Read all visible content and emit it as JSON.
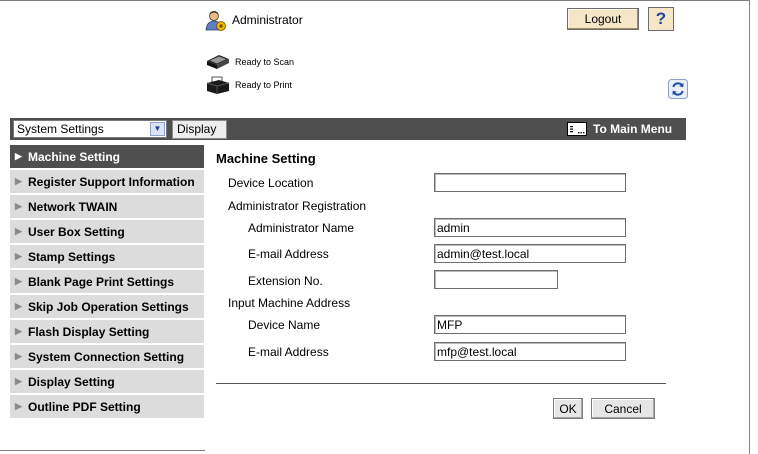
{
  "header": {
    "user_label": "Administrator",
    "logout_label": "Logout",
    "help_label": "?"
  },
  "status": {
    "scan": "Ready to Scan",
    "print": "Ready to Print"
  },
  "toolbar": {
    "settings_select_value": "System Settings",
    "display_label": "Display",
    "main_menu_label": "To Main Menu"
  },
  "sidebar": {
    "items": [
      {
        "label": "Machine Setting"
      },
      {
        "label": "Register Support Information"
      },
      {
        "label": "Network TWAIN"
      },
      {
        "label": "User Box Setting"
      },
      {
        "label": "Stamp Settings"
      },
      {
        "label": "Blank Page Print Settings"
      },
      {
        "label": "Skip Job Operation Settings"
      },
      {
        "label": "Flash Display Setting"
      },
      {
        "label": "System Connection Setting"
      },
      {
        "label": "Display Setting"
      },
      {
        "label": "Outline PDF Setting"
      }
    ]
  },
  "form": {
    "title": "Machine Setting",
    "device_location_label": "Device Location",
    "device_location_value": "",
    "admin_registration_label": "Administrator Registration",
    "admin_name_label": "Administrator Name",
    "admin_name_value": "admin",
    "admin_email_label": "E-mail Address",
    "admin_email_value": "admin@test.local",
    "extension_label": "Extension No.",
    "extension_value": "",
    "input_machine_address_label": "Input Machine Address",
    "device_name_label": "Device Name",
    "device_name_value": "MFP",
    "machine_email_label": "E-mail Address",
    "machine_email_value": "mfp@test.local",
    "ok_label": "OK",
    "cancel_label": "Cancel"
  },
  "colors": {
    "toolbar_bg": "#4f4f4f",
    "sidebar_item_bg": "#dcdcdc",
    "button_bg": "#f5e6c8",
    "help_color": "#1b46a6"
  }
}
